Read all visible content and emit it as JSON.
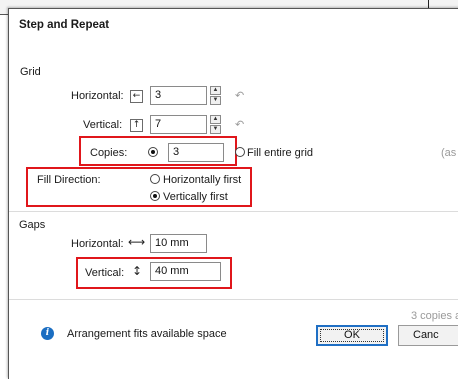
{
  "dialog": {
    "title": "Step and Repeat",
    "grid": {
      "heading": "Grid",
      "horizontal": {
        "label": "Horizontal:",
        "icon": "arrow-left-icon",
        "value": "3"
      },
      "vertical": {
        "label": "Vertical:",
        "icon": "arrow-up-icon",
        "value": "7"
      },
      "copies": {
        "label": "Copies:",
        "value": "3",
        "selected": true
      },
      "fill_entire_grid": {
        "label": "Fill entire grid",
        "selected": false
      },
      "right_hint": "(as"
    },
    "fill_direction": {
      "label": "Fill Direction:",
      "options": [
        {
          "label": "Horizontally first",
          "selected": false
        },
        {
          "label": "Vertically first",
          "selected": true
        }
      ]
    },
    "gaps": {
      "heading": "Gaps",
      "horizontal": {
        "label": "Horizontal:",
        "icon": "horizontal-arrows-icon",
        "glyph": "⟷",
        "value": "10 mm"
      },
      "vertical": {
        "label": "Vertical:",
        "icon": "vertical-arrows-icon",
        "glyph": "↕",
        "value": "40 mm"
      }
    },
    "summary": "3 copies a",
    "status": {
      "icon": "info-icon",
      "glyph": "i",
      "text": "Arrangement fits available space"
    },
    "buttons": {
      "ok": "OK",
      "cancel": "Canc"
    },
    "highlight_color": "#e0161b"
  }
}
